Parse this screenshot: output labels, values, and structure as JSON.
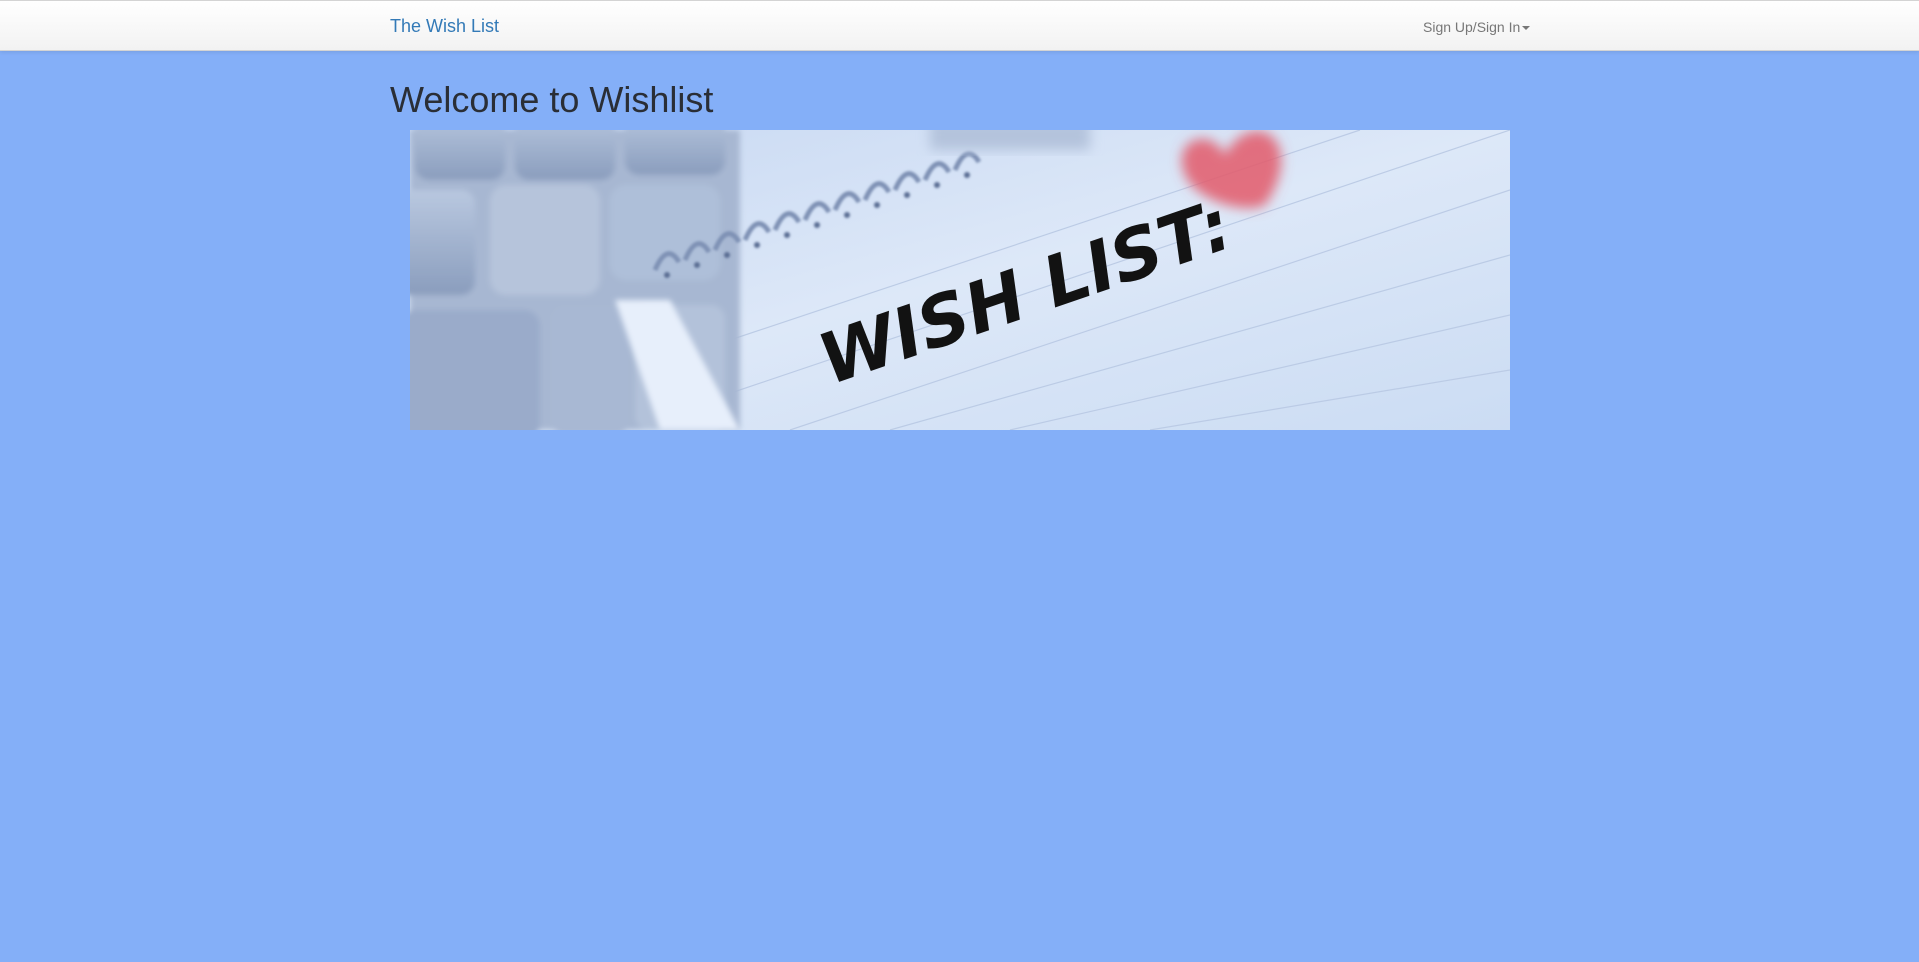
{
  "navbar": {
    "brand": "The Wish List",
    "auth_menu_label": "Sign Up/Sign In"
  },
  "main": {
    "title": "Welcome to Wishlist",
    "banner": {
      "handwritten_text": "WISH LIST:"
    }
  },
  "colors": {
    "page_background": "#84aff8",
    "brand_link": "#337ab7",
    "heading": "#2a2e36",
    "nav_text": "#777777",
    "heart": "#e35a6a"
  },
  "icons": {
    "dropdown": "caret-down-icon"
  }
}
